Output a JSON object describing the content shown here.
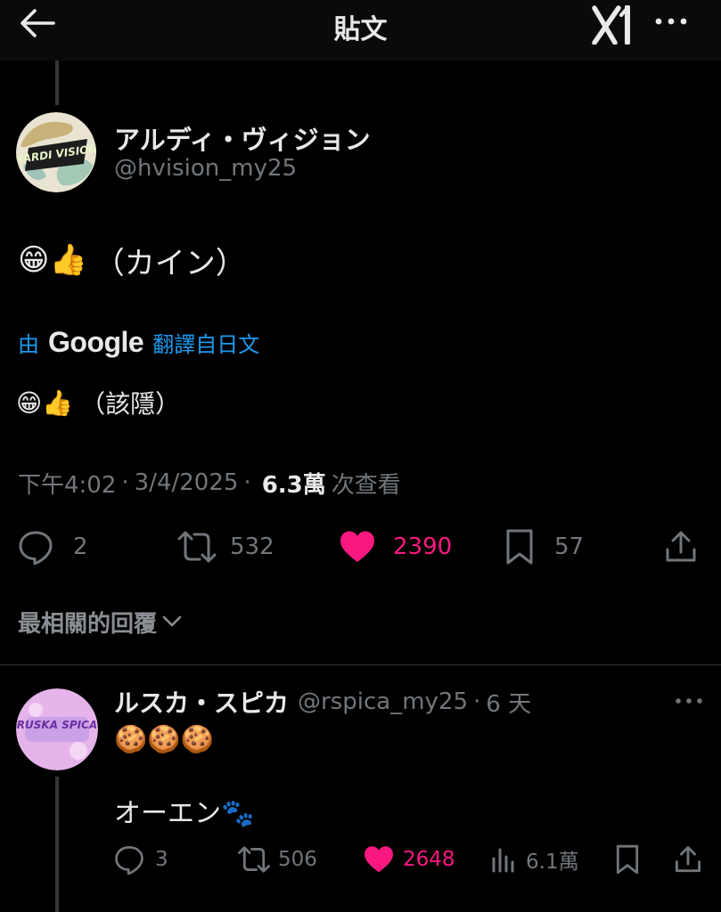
{
  "header": {
    "title": "貼文"
  },
  "post": {
    "author": {
      "display_name": "アルディ・ヴィジョン",
      "handle": "@hvision_my25",
      "avatar_text": "HARDI VISION"
    },
    "text_emoji": "😁👍",
    "text": "（カイン）",
    "translation": {
      "prefix": "由",
      "provider": "Google",
      "suffix": "翻譯自日文",
      "text_emoji": "😁👍",
      "text": "（該隱）"
    },
    "meta": {
      "time": "下午4:02",
      "sep1": "·",
      "date": "3/4/2025",
      "sep2": "·",
      "views": "6.3萬",
      "views_label": "次查看"
    },
    "actions": {
      "replies": "2",
      "reposts": "532",
      "likes": "2390",
      "bookmarks": "57"
    }
  },
  "sort": {
    "label": "最相關的回覆"
  },
  "reply": {
    "author": {
      "display_name": "ルスカ・スピカ",
      "handle": "@rspica_my25",
      "sep": "·",
      "time": "6 天",
      "avatar_text": "RUSKA SPICA"
    },
    "line1": "🍪🍪🍪",
    "line2": "オーエン🐾",
    "actions": {
      "replies": "3",
      "reposts": "506",
      "likes": "2648",
      "views": "6.1萬"
    }
  },
  "colors": {
    "background": "#000000",
    "text": "#e7e9ea",
    "muted": "#71767b",
    "link": "#1d9bf0",
    "like": "#f91880"
  }
}
